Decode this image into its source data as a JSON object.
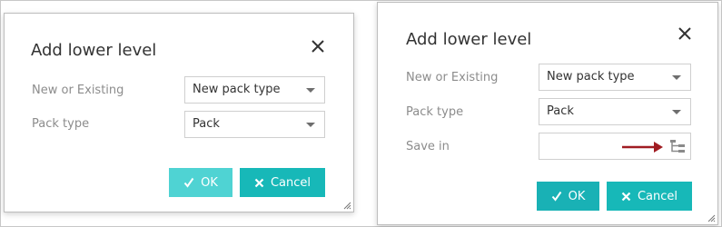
{
  "dialog_left": {
    "title": "Add lower level",
    "fields": [
      {
        "label": "New or Existing",
        "value": "New pack type"
      },
      {
        "label": "Pack type",
        "value": "Pack"
      }
    ],
    "ok_label": "OK",
    "cancel_label": "Cancel"
  },
  "dialog_right": {
    "title": "Add lower level",
    "fields": [
      {
        "label": "New or Existing",
        "value": "New pack type"
      },
      {
        "label": "Pack type",
        "value": "Pack"
      },
      {
        "label": "Save in",
        "value": ""
      }
    ],
    "ok_label": "OK",
    "cancel_label": "Cancel"
  },
  "colors": {
    "accent": "#17b8b8",
    "ok_light": "#4fd3d3",
    "annotation_arrow": "#a01c22"
  },
  "icons": [
    "close-icon",
    "checkmark-icon",
    "x-icon",
    "tree-structure-icon",
    "resize-grip-icon",
    "red-arrow-annotation"
  ]
}
